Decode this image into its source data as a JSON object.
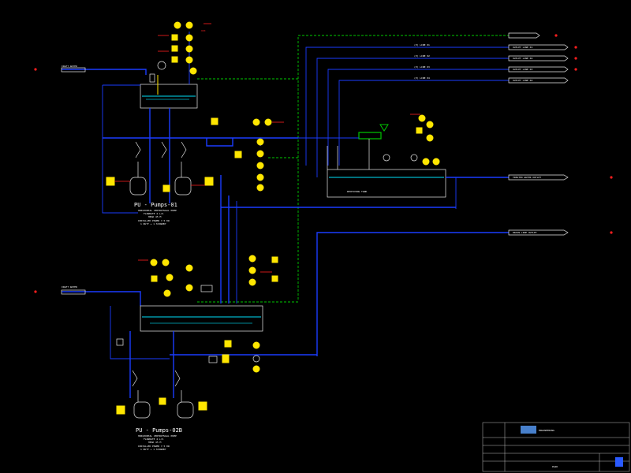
{
  "drawing": {
    "pump_unit_1": {
      "title": "PU - Pumps-01",
      "notes": [
        "HORIZONTAL CENTRIFUGAL PUMP",
        "FLOWRATE 4 L/S",
        "HEAD 45 M",
        "INSTALLED POWER 7.5 KW",
        "1 DUTY + 1 STANDBY"
      ]
    },
    "pump_unit_2": {
      "title": "PU - Pumps-02B",
      "notes": [
        "HORIZONTAL CENTRIFUGAL PUMP",
        "FLOWRATE 4 L/S",
        "HEAD 45 M",
        "INSTALLED POWER 7.5 KW",
        "1 DUTY + 1 STANDBY"
      ]
    },
    "right_outlets": [
      "OUTLET LINE 01",
      "OUTLET LINE 02",
      "OUTLET LINE 03",
      "OUTLET LINE 04"
    ],
    "right_outlet_labels": [
      "(P) LINE 01",
      "(P) LINE 02",
      "(P) LINE 03",
      "(P) LINE 04"
    ],
    "mid_outlet": "TREATED WATER OUTLET",
    "lower_outlet": "DRAIN LINE OUTLET",
    "left_inlet_1": "INLET WATER",
    "left_inlet_2": "INLET WATER",
    "tank_label": "RECEIVING TANK",
    "title_block": {
      "company": "ENGINEERING",
      "sheet": "P&ID"
    }
  },
  "colors": {
    "background": "#000000",
    "process_line": "#1a3cff",
    "signal_line": "#00c800",
    "instrument": "#ffe600",
    "alarm": "#ff1e1e"
  }
}
